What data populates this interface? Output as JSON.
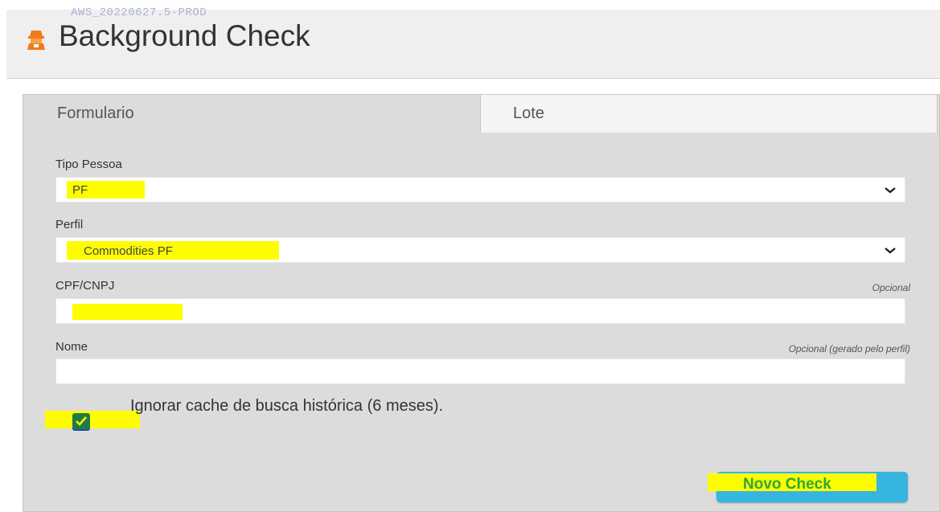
{
  "header": {
    "build": "AWS_20220627.5-PROD",
    "title": "Background Check",
    "icon": "agent-icon"
  },
  "tabs": [
    {
      "label": "Formulario",
      "active": true
    },
    {
      "label": "Lote",
      "active": false
    }
  ],
  "form": {
    "tipo_pessoa": {
      "label": "Tipo Pessoa",
      "value": "PF"
    },
    "perfil": {
      "label": "Perfil",
      "value": "Commodities PF"
    },
    "cpf_cnpj": {
      "label": "CPF/CNPJ",
      "optional": "Opcional",
      "value": ""
    },
    "nome": {
      "label": "Nome",
      "optional": "Opcional (gerado pelo perfil)",
      "value": ""
    },
    "ignore_cache": {
      "label": "Ignorar cache de busca histórica (6 meses).",
      "checked": true
    }
  },
  "actions": {
    "submit_label": "Novo Check"
  },
  "colors": {
    "highlight": "#fdfd00",
    "button": "#36b5e0",
    "checkbox": "#1e7b46",
    "accent_icon": "#f07b1d"
  }
}
